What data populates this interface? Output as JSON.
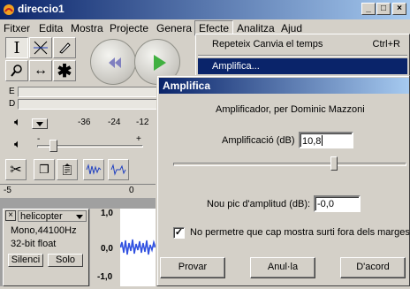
{
  "app": {
    "title": "direccio1",
    "menus": [
      "Fitxer",
      "Edita",
      "Mostra",
      "Projecte",
      "Genera",
      "Efecte",
      "Analitza",
      "Ajud"
    ]
  },
  "meters": {
    "rows": [
      "E",
      "D"
    ],
    "scale": [
      "-36",
      "-24",
      "-12"
    ]
  },
  "slider": {
    "minus": "-",
    "plus": "+"
  },
  "ruler": {
    "start": "-5",
    "mid": "0"
  },
  "track": {
    "name": "helicopter",
    "info1": "Mono,44100Hz",
    "info2": "32-bit float",
    "mute": "Silenci",
    "solo": "Solo",
    "scale": [
      "1,0",
      "0,0",
      "-1,0"
    ]
  },
  "efecte_menu": {
    "repeat_label": "Repeteix Canvia el temps",
    "repeat_shortcut": "Ctrl+R",
    "amplify_label": "Amplifica..."
  },
  "dialog": {
    "title": "Amplifica",
    "heading": "Amplificador, per Dominic Mazzoni",
    "amp_label": "Amplificació (dB)",
    "amp_value": "10,8",
    "peak_label": "Nou pic d'amplitud (dB):",
    "peak_value": "-0,0",
    "no_clip_label": "No permetre que cap mostra surti fora dels marges",
    "no_clip_checked": true,
    "slider_fraction": 0.69,
    "preview_button": "Provar",
    "cancel_button": "Anul·la",
    "ok_button": "D'acord"
  }
}
